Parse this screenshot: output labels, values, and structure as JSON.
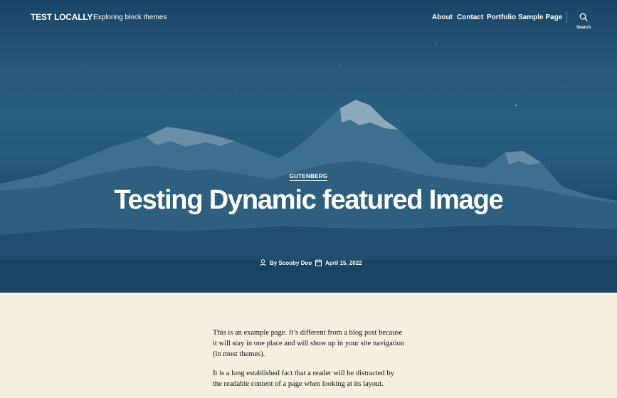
{
  "site": {
    "title": "TEST LOCALLY",
    "tagline": "Exploring block themes"
  },
  "nav": {
    "items": [
      {
        "label": "About"
      },
      {
        "label": "Contact"
      },
      {
        "label": "Portfolio"
      },
      {
        "label": "Sample Page"
      }
    ],
    "search_label": "Search"
  },
  "post": {
    "category": "GUTENBERG",
    "title": "Testing Dynamic featured Image",
    "author": "By Scooby Doo",
    "date": "April 15, 2022"
  },
  "content": {
    "paragraphs": [
      "This is an example page. It’s different from a blog post because it will stay in one place and will show up in your site navigation (in most themes).",
      "It is a long established fact that a reader will be distracted by the readable content of a page when looking at its layout."
    ]
  },
  "colors": {
    "hero_overlay": "#245677",
    "content_background": "#f5efe0",
    "text": "#ffffff"
  }
}
